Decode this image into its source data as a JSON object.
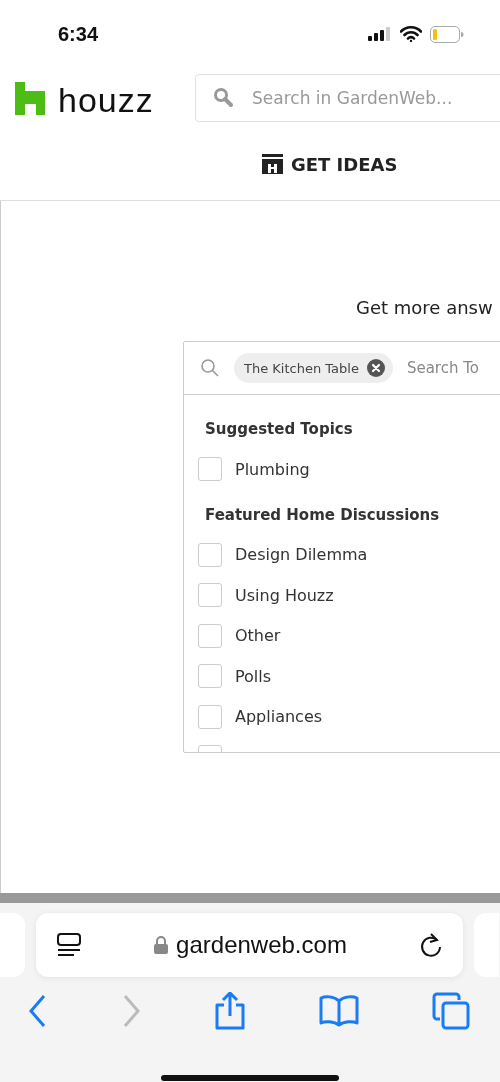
{
  "status_bar": {
    "time": "6:34"
  },
  "header": {
    "logo": "houzz",
    "search": {
      "placeholder": "Search in GardenWeb..."
    }
  },
  "nav": {
    "label": "GET IDEAS"
  },
  "panel": {
    "heading": "Get more answ",
    "topic_search": {
      "chip": "The Kitchen Table",
      "placeholder": "Search To"
    },
    "groups": [
      {
        "title": "Suggested Topics",
        "items": [
          {
            "label": "Plumbing",
            "checked": false
          }
        ]
      },
      {
        "title": "Featured Home Discussions",
        "items": [
          {
            "label": "Design Dilemma",
            "checked": false
          },
          {
            "label": "Using Houzz",
            "checked": false
          },
          {
            "label": "Other",
            "checked": false
          },
          {
            "label": "Polls",
            "checked": false
          },
          {
            "label": "Appliances",
            "checked": false
          },
          {
            "checked": false
          }
        ]
      }
    ]
  },
  "browser": {
    "url": "gardenweb.com",
    "back_disabled": false,
    "forward_disabled": true
  }
}
